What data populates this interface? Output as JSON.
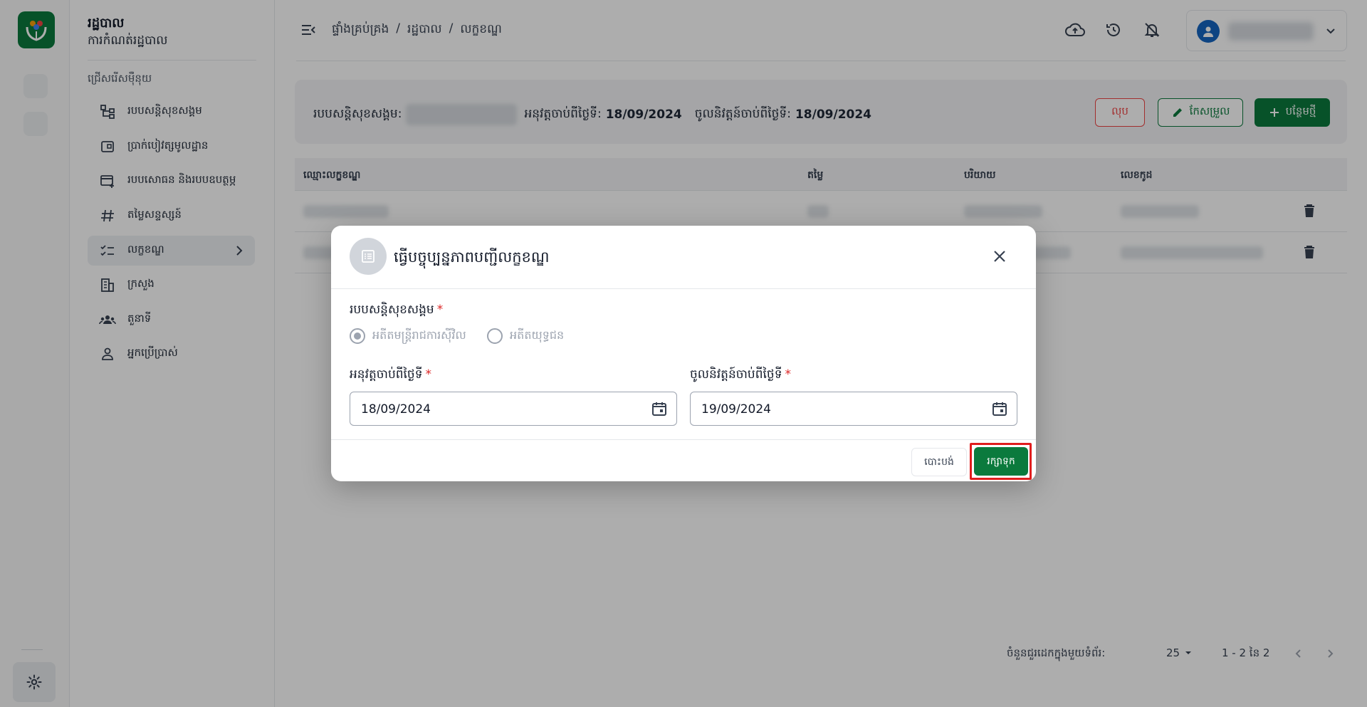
{
  "app": {
    "title": "រដ្ឋបាល",
    "subtitle": "ការកំណត់រដ្ឋបាល"
  },
  "sidebar": {
    "section_label": "ជ្រើសរើសម៉ឺនុយ",
    "items": [
      {
        "label": "របបសន្តិសុខសង្គម",
        "icon": "hierarchy-icon"
      },
      {
        "label": "ប្រាក់បៀវត្សមូលដ្ឋាន",
        "icon": "wallet-icon"
      },
      {
        "label": "របបសោធន និងរបបឧបត្ថម្ភ",
        "icon": "card-add-icon"
      },
      {
        "label": "តម្លៃសន្ទស្សន៍",
        "icon": "hash-icon"
      },
      {
        "label": "លក្ខខណ្ឌ",
        "icon": "checklist-icon"
      },
      {
        "label": "ក្រសួង",
        "icon": "building-icon"
      },
      {
        "label": "តួនាទី",
        "icon": "group-icon"
      },
      {
        "label": "អ្នកប្រើប្រាស់",
        "icon": "person-icon"
      }
    ]
  },
  "header": {
    "breadcrumb": [
      "ផ្ទាំងគ្រប់គ្រង",
      "/",
      "រដ្ឋបាល",
      "/",
      "លក្ខខណ្ឌ"
    ]
  },
  "infobar": {
    "scheme_label": "របបសន្តិសុខសង្គម:",
    "effective_label": "អនុវត្តចាប់ពីថ្ងៃទី:",
    "effective_value": "18/09/2024",
    "enforce_label": "ចូលនិវត្តន៍ចាប់ពីថ្ងៃទី:",
    "enforce_value": "18/09/2024",
    "delete_label": "លុប",
    "edit_label": "កែសម្រួល",
    "add_label": "បន្ថែមថ្មី"
  },
  "table": {
    "columns": [
      "ឈ្មោះលក្ខខណ្ឌ",
      "តម្លៃ",
      "បរិយាយ",
      "លេខកូដ"
    ]
  },
  "pagination": {
    "rows_label": "ចំនួនជួរដេកក្នុងមួយទំព័រ:",
    "rows_value": "25",
    "range": "1 - 2 នៃ 2"
  },
  "modal": {
    "title": "ធ្វើបច្ចុប្បន្នភាពបញ្ជីលក្ខខណ្ឌ",
    "scheme_label": "របបសន្តិសុខសង្គម",
    "required_mark": "*",
    "radio_options": [
      {
        "label": "អតីតមន្ត្រីរាជការស៊ីវិល",
        "selected": true
      },
      {
        "label": "អតីតយុទ្ធជន",
        "selected": false
      }
    ],
    "effective_label": "អនុវត្តចាប់ពីថ្ងៃទី",
    "effective_value": "18/09/2024",
    "enforce_label": "ចូលនិវត្តន៍ចាប់ពីថ្ងៃទី",
    "enforce_value": "19/09/2024",
    "cancel_label": "បោះបង់",
    "save_label": "រក្សាទុក"
  },
  "colors": {
    "brand_green": "#0b7a3d",
    "danger": "#ef4444",
    "highlight": "#e11d1d"
  }
}
